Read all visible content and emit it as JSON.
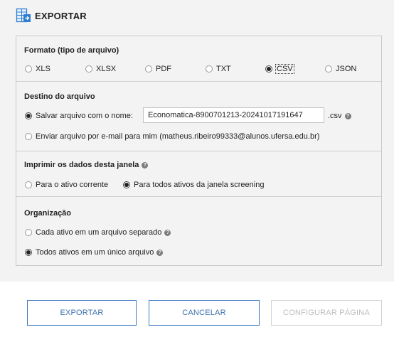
{
  "header": {
    "title": "EXPORTAR",
    "icon": "table-export-icon"
  },
  "format": {
    "title": "Formato (tipo de arquivo)",
    "options": [
      {
        "label": "XLS",
        "checked": false
      },
      {
        "label": "XLSX",
        "checked": false
      },
      {
        "label": "PDF",
        "checked": false
      },
      {
        "label": "TXT",
        "checked": false
      },
      {
        "label": "CSV",
        "checked": true
      },
      {
        "label": "JSON",
        "checked": false
      }
    ]
  },
  "destination": {
    "title": "Destino do arquivo",
    "save_label": "Salvar arquivo com o nome:",
    "filename": "Economatica-8900701213-20241017191647",
    "extension": ".csv",
    "email_label": "Enviar arquivo por e-mail para mim (matheus.ribeiro99333@alunos.ufersa.edu.br)"
  },
  "print": {
    "title": "Imprimir os dados desta janela",
    "current_label": "Para o ativo corrente",
    "all_label": "Para todos ativos da janela screening"
  },
  "organization": {
    "title": "Organização",
    "separate_label": "Cada ativo em um arquivo separado",
    "single_label": "Todos ativos em um único arquivo"
  },
  "buttons": {
    "export": "EXPORTAR",
    "cancel": "CANCELAR",
    "configure": "CONFIGURAR PÁGINA"
  },
  "help_glyph": "?",
  "colors": {
    "accent": "#3b78c3",
    "icon_blue": "#2f7fd0",
    "panel_bg": "#f3f3f3"
  }
}
